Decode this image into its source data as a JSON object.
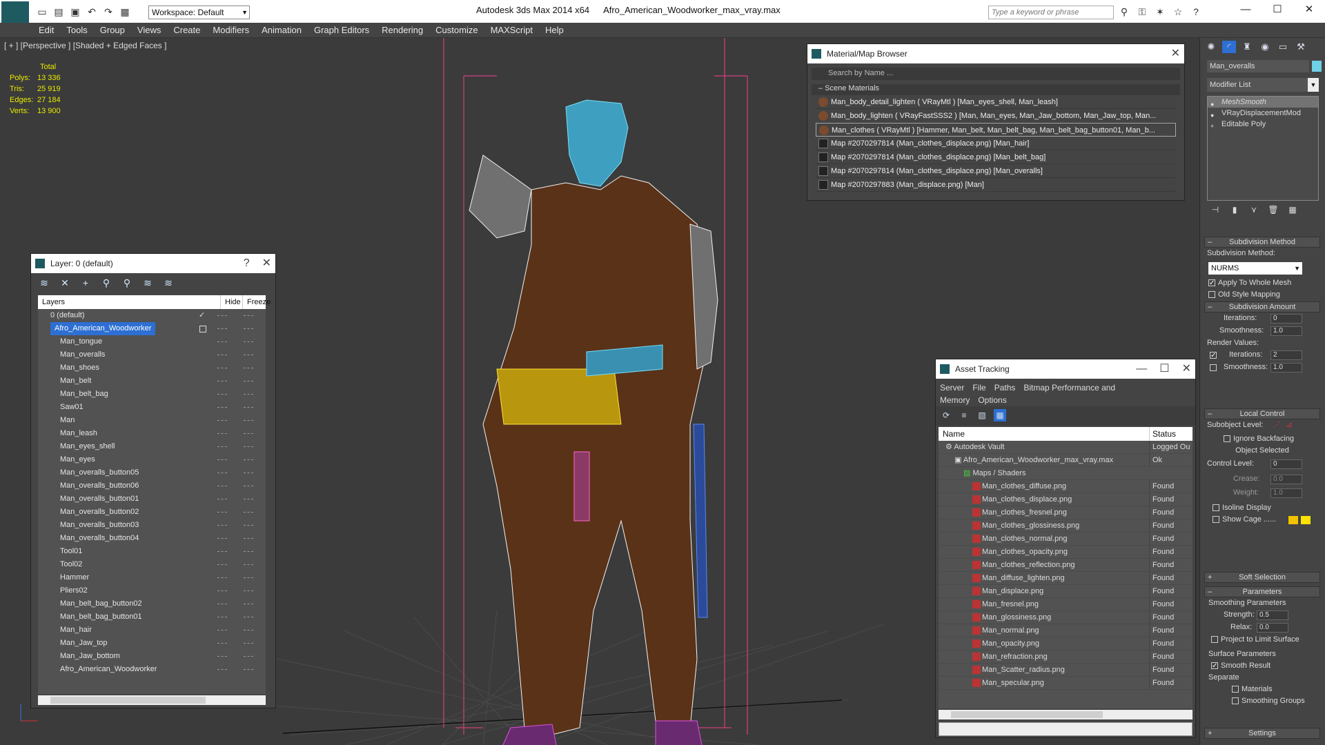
{
  "titlebar": {
    "app": "Autodesk 3ds Max  2014 x64",
    "file": "Afro_American_Woodworker_max_vray.max",
    "workspace": "Workspace: Default",
    "search_placeholder": "Type a keyword or phrase"
  },
  "menu": [
    "Edit",
    "Tools",
    "Group",
    "Views",
    "Create",
    "Modifiers",
    "Animation",
    "Graph Editors",
    "Rendering",
    "Customize",
    "MAXScript",
    "Help"
  ],
  "viewport": {
    "label": "[ + ] [Perspective ] [Shaded + Edged Faces ]",
    "stats": {
      "total_label": "Total",
      "rows": [
        {
          "k": "Polys:",
          "v": "13 336"
        },
        {
          "k": "Tris:",
          "v": "25 919"
        },
        {
          "k": "Edges:",
          "v": "27 184"
        },
        {
          "k": "Verts:",
          "v": "13 900"
        }
      ]
    }
  },
  "layer_window": {
    "title": "Layer: 0 (default)",
    "help": "?",
    "col_layers": "Layers",
    "col_hide": "Hide",
    "col_freeze": "Freeze",
    "rows": [
      {
        "name": "0 (default)",
        "level": 1,
        "check": true
      },
      {
        "name": "Afro_American_Woodworker",
        "level": 1,
        "selected": true
      },
      {
        "name": "Man_tongue",
        "level": 2
      },
      {
        "name": "Man_overalls",
        "level": 2
      },
      {
        "name": "Man_shoes",
        "level": 2
      },
      {
        "name": "Man_belt",
        "level": 2
      },
      {
        "name": "Man_belt_bag",
        "level": 2
      },
      {
        "name": "Saw01",
        "level": 2
      },
      {
        "name": "Man",
        "level": 2
      },
      {
        "name": "Man_leash",
        "level": 2
      },
      {
        "name": "Man_eyes_shell",
        "level": 2
      },
      {
        "name": "Man_eyes",
        "level": 2
      },
      {
        "name": "Man_overalls_button05",
        "level": 2
      },
      {
        "name": "Man_overalls_button06",
        "level": 2
      },
      {
        "name": "Man_overalls_button01",
        "level": 2
      },
      {
        "name": "Man_overalls_button02",
        "level": 2
      },
      {
        "name": "Man_overalls_button03",
        "level": 2
      },
      {
        "name": "Man_overalls_button04",
        "level": 2
      },
      {
        "name": "Tool01",
        "level": 2
      },
      {
        "name": "Tool02",
        "level": 2
      },
      {
        "name": "Hammer",
        "level": 2
      },
      {
        "name": "Pliers02",
        "level": 2
      },
      {
        "name": "Man_belt_bag_button02",
        "level": 2
      },
      {
        "name": "Man_belt_bag_button01",
        "level": 2
      },
      {
        "name": "Man_hair",
        "level": 2
      },
      {
        "name": "Man_Jaw_top",
        "level": 2
      },
      {
        "name": "Man_Jaw_bottom",
        "level": 2
      },
      {
        "name": "Afro_American_Woodworker",
        "level": 2
      }
    ]
  },
  "material_browser": {
    "title": "Material/Map Browser",
    "search": "Search by Name ...",
    "section": "Scene Materials",
    "rows": [
      {
        "text": "Man_body_detail_lighten  ( VRayMtl ) [Man_eyes_shell, Man_leash]",
        "kind": "mat"
      },
      {
        "text": "Man_body_lighten  ( VRayFastSSS2 ) [Man, Man_eyes, Man_Jaw_bottom, Man_Jaw_top, Man...",
        "kind": "mat"
      },
      {
        "text": "Man_clothes  ( VRayMtl ) [Hammer, Man_belt, Man_belt_bag, Man_belt_bag_button01, Man_b...",
        "kind": "mat",
        "highlight": true
      },
      {
        "text": "Map #2070297814 (Man_clothes_displace.png) [Man_hair]",
        "kind": "map"
      },
      {
        "text": "Map #2070297814 (Man_clothes_displace.png) [Man_belt_bag]",
        "kind": "map"
      },
      {
        "text": "Map #2070297814 (Man_clothes_displace.png) [Man_overalls]",
        "kind": "map"
      },
      {
        "text": "Map #2070297883 (Man_displace.png) [Man]",
        "kind": "map"
      }
    ]
  },
  "asset_tracking": {
    "title": "Asset Tracking",
    "menu": [
      "Server",
      "File",
      "Paths",
      "Bitmap Performance and Memory",
      "Options"
    ],
    "col_name": "Name",
    "col_status": "Status",
    "rows": [
      {
        "name": "Autodesk Vault",
        "status": "Logged Ou",
        "level": 0
      },
      {
        "name": "Afro_American_Woodworker_max_vray.max",
        "status": "Ok",
        "level": 1
      },
      {
        "name": "Maps / Shaders",
        "status": "",
        "level": 2
      },
      {
        "name": "Man_clothes_diffuse.png",
        "status": "Found",
        "level": 3
      },
      {
        "name": "Man_clothes_displace.png",
        "status": "Found",
        "level": 3
      },
      {
        "name": "Man_clothes_fresnel.png",
        "status": "Found",
        "level": 3
      },
      {
        "name": "Man_clothes_glossiness.png",
        "status": "Found",
        "level": 3
      },
      {
        "name": "Man_clothes_normal.png",
        "status": "Found",
        "level": 3
      },
      {
        "name": "Man_clothes_opacity.png",
        "status": "Found",
        "level": 3
      },
      {
        "name": "Man_clothes_reflection.png",
        "status": "Found",
        "level": 3
      },
      {
        "name": "Man_diffuse_lighten.png",
        "status": "Found",
        "level": 3
      },
      {
        "name": "Man_displace.png",
        "status": "Found",
        "level": 3
      },
      {
        "name": "Man_fresnel.png",
        "status": "Found",
        "level": 3
      },
      {
        "name": "Man_glossiness.png",
        "status": "Found",
        "level": 3
      },
      {
        "name": "Man_normal.png",
        "status": "Found",
        "level": 3
      },
      {
        "name": "Man_opacity.png",
        "status": "Found",
        "level": 3
      },
      {
        "name": "Man_refraction.png",
        "status": "Found",
        "level": 3
      },
      {
        "name": "Man_Scatter_radius.png",
        "status": "Found",
        "level": 3
      },
      {
        "name": "Man_specular.png",
        "status": "Found",
        "level": 3
      }
    ]
  },
  "command_panel": {
    "object_name": "Man_overalls",
    "modifier_list": "Modifier List",
    "stack": [
      "MeshSmooth",
      "VRayDisplacementMod",
      "Editable Poly"
    ],
    "subdivision_method": {
      "header": "Subdivision Method",
      "label": "Subdivision Method:",
      "value": "NURMS",
      "apply_whole": "Apply To Whole Mesh",
      "old_style": "Old Style Mapping"
    },
    "subdivision_amount": {
      "header": "Subdivision Amount",
      "iterations_label": "Iterations:",
      "iterations": "0",
      "smoothness_label": "Smoothness:",
      "smoothness": "1.0",
      "render_values": "Render Values:",
      "r_iterations_label": "Iterations:",
      "r_iterations": "2",
      "r_smoothness_label": "Smoothness:",
      "r_smoothness": "1.0"
    },
    "local_control": {
      "header": "Local Control",
      "subobject": "Subobject Level:",
      "ignore_backfacing": "Ignore Backfacing",
      "object_selected": "Object Selected",
      "control_level_label": "Control Level:",
      "control_level": "0",
      "crease_label": "Crease:",
      "crease": "0.0",
      "weight_label": "Weight:",
      "weight": "1.0",
      "isoline": "Isoline Display",
      "show_cage": "Show Cage ......"
    },
    "soft_selection": "Soft Selection",
    "parameters": {
      "header": "Parameters",
      "smoothing": "Smoothing Parameters",
      "strength_label": "Strength:",
      "strength": "0.5",
      "relax_label": "Relax:",
      "relax": "0.0",
      "project": "Project to Limit Surface",
      "surface": "Surface Parameters",
      "smooth_result": "Smooth Result",
      "separate": "Separate",
      "materials": "Materials",
      "smoothing_groups": "Smoothing Groups"
    },
    "settings": "Settings"
  },
  "colors": {
    "accent": "#2d6fd3",
    "stats": "#eaea00",
    "cage1": "#f2c200",
    "cage2": "#ffe200",
    "object": "#6fd0e8"
  }
}
